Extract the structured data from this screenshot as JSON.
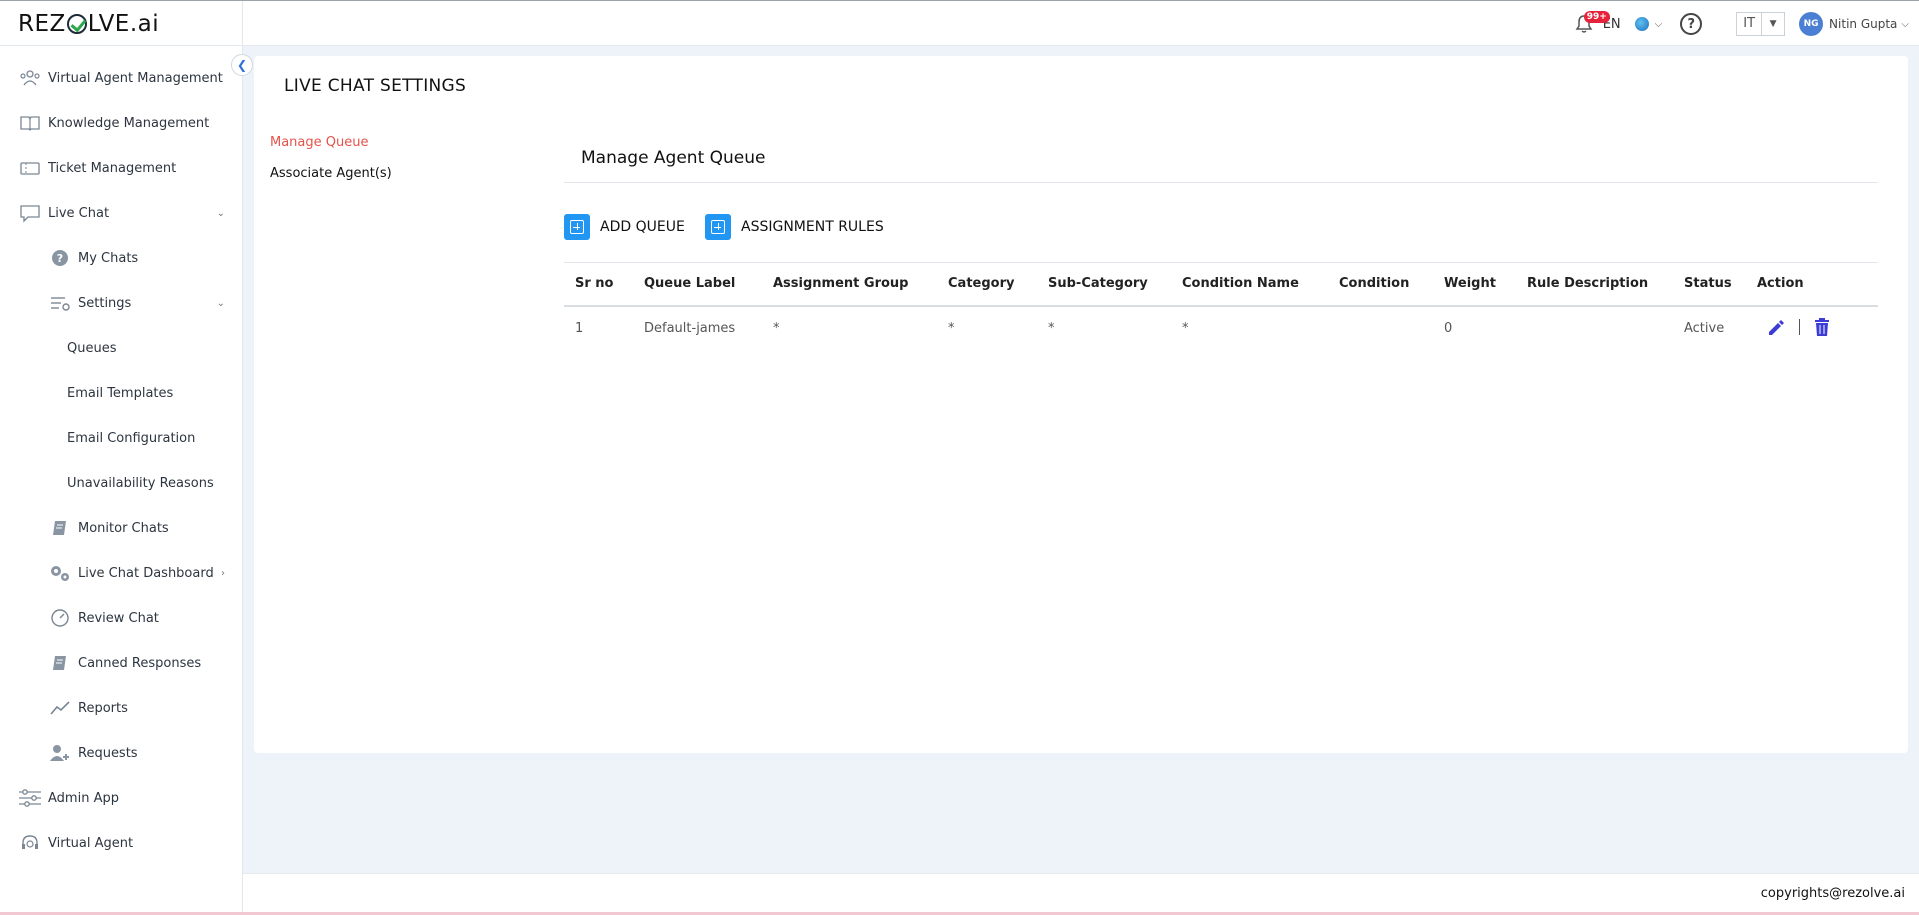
{
  "brand": {
    "logo_text_left": "REZ",
    "logo_text_right": "LVE.ai"
  },
  "topbar": {
    "notification_badge": "99+",
    "language": "EN",
    "help_label": "?",
    "it_select_value": "IT",
    "avatar_initials": "NG",
    "username": "Nitin Gupta"
  },
  "sidebar": {
    "items": [
      {
        "label": "Virtual Agent Management",
        "icon": "users-icon"
      },
      {
        "label": "Knowledge Management",
        "icon": "book-open-icon"
      },
      {
        "label": "Ticket Management",
        "icon": "ticket-icon"
      },
      {
        "label": "Live Chat",
        "icon": "chat-icon"
      },
      {
        "label": "My Chats",
        "icon": "question-circle-icon"
      },
      {
        "label": "Settings",
        "icon": "settings-sliders-icon"
      },
      {
        "label": "Queues"
      },
      {
        "label": "Email Templates"
      },
      {
        "label": "Email Configuration"
      },
      {
        "label": "Unavailability Reasons"
      },
      {
        "label": "Monitor Chats",
        "icon": "notebook-icon"
      },
      {
        "label": "Live Chat Dashboard",
        "icon": "gears-icon"
      },
      {
        "label": "Review Chat",
        "icon": "gauge-icon"
      },
      {
        "label": "Canned Responses",
        "icon": "notebook-icon"
      },
      {
        "label": "Reports",
        "icon": "trend-line-icon"
      },
      {
        "label": "Requests",
        "icon": "user-plus-icon"
      },
      {
        "label": "Admin App",
        "icon": "sliders-icon"
      },
      {
        "label": "Virtual Agent",
        "icon": "headset-icon"
      }
    ]
  },
  "panel": {
    "title": "LIVE CHAT SETTINGS",
    "side_links": [
      "Manage Queue",
      "Associate Agent(s)"
    ],
    "section_title": "Manage Agent Queue",
    "add_queue_label": "ADD QUEUE",
    "assignment_rules_label": "ASSIGNMENT RULES",
    "table": {
      "headers": [
        "Sr no",
        "Queue Label",
        "Assignment Group",
        "Category",
        "Sub-Category",
        "Condition Name",
        "Condition",
        "Weight",
        "Rule Description",
        "Status",
        "Action"
      ],
      "rows": [
        [
          "1",
          "Default-james",
          "*",
          "*",
          "*",
          "*",
          "",
          "0",
          "",
          "Active"
        ]
      ]
    }
  },
  "footer": {
    "text": "copyrights@rezolve.ai"
  },
  "colors": {
    "accent": "#2196f3",
    "active_link": "#e5534b",
    "edit_icon": "#3b3bd8"
  }
}
